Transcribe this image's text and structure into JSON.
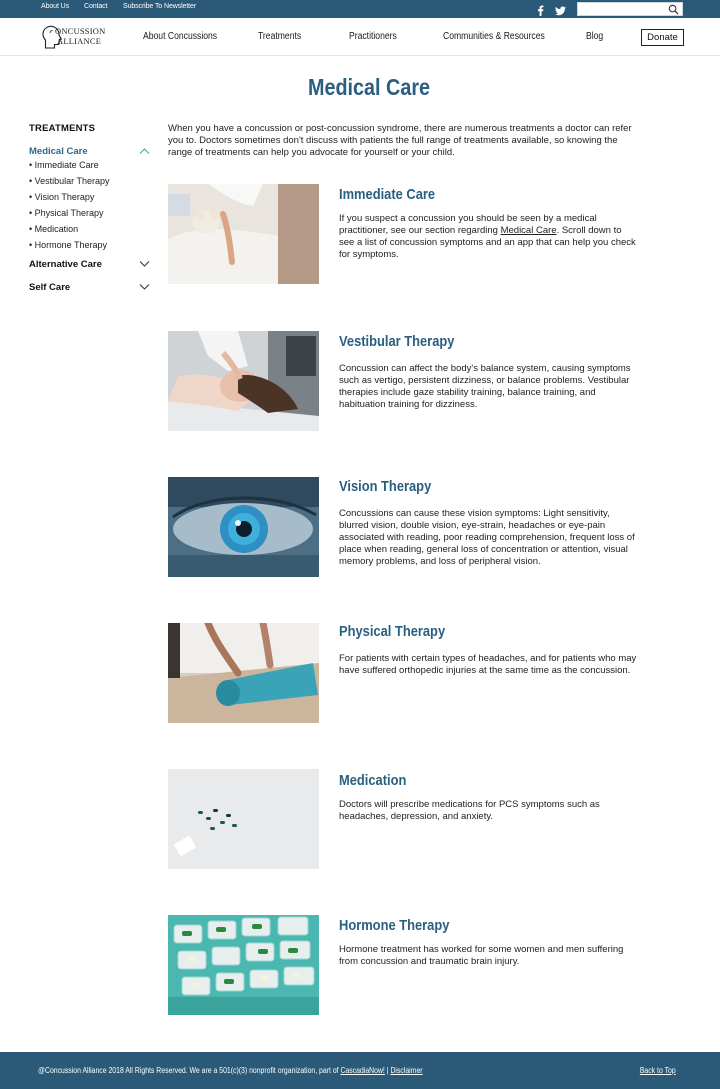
{
  "topbar": {
    "links": [
      "About Us",
      "Contact",
      "Subscribe To Newsletter"
    ],
    "social": [
      "facebook-icon",
      "twitter-icon"
    ],
    "search_placeholder": ""
  },
  "nav": {
    "logo_line1": "ONCUSSION",
    "logo_line2": "ALLIANCE",
    "items": [
      "About Concussions",
      "Treatments",
      "Practitioners",
      "Communities & Resources",
      "Blog"
    ],
    "donate": "Donate"
  },
  "page": {
    "title": "Medical Care",
    "intro": "When you have a concussion or post-concussion syndrome, there are numerous treatments a doctor can refer you to. Doctors sometimes don't discuss with patients the full range of treatments available, so knowing the range of treatments can help you advocate for yourself or your child."
  },
  "sidebar": {
    "heading": "TREATMENTS",
    "categories": [
      "Medical Care",
      "Alternative Care",
      "Self Care"
    ],
    "subitems": [
      "• Immediate Care",
      "• Vestibular Therapy",
      "• Vision Therapy",
      "• Physical Therapy",
      "• Medication",
      "• Hormone Therapy"
    ]
  },
  "treatments": [
    {
      "title": "Immediate Care",
      "desc_before": "If you suspect a concussion you should be seen by a medical practitioner, see our section regarding ",
      "desc_link": "Medical Care",
      "desc_after": ". Scroll down to see a list of concussion symptoms and an app that can help you check for symptoms."
    },
    {
      "title": "Vestibular Therapy",
      "desc": "Concussion can affect the body's balance system, causing symptoms such as vertigo, persistent dizziness, or balance problems. Vestibular therapies include gaze stability training, balance training, and habituation training for dizziness."
    },
    {
      "title": "Vision Therapy",
      "desc": "Concussions can cause these vision symptoms: Light sensitivity, blurred vision, double vision, eye-strain, headaches or eye-pain associated with reading, poor reading comprehension, frequent loss of place when reading, general loss of concentration or attention, visual memory problems, and loss of peripheral vision."
    },
    {
      "title": "Physical Therapy",
      "desc": "For patients with certain types of headaches, and for patients who may have suffered orthopedic injuries at the same time as the concussion."
    },
    {
      "title": "Medication",
      "desc": "Doctors will prescribe medications for PCS symptoms such as headaches, depression, and anxiety."
    },
    {
      "title": "Hormone Therapy",
      "desc": "Hormone treatment has worked for some women and men suffering from concussion and traumatic brain injury."
    }
  ],
  "footer": {
    "text": "@Concussion Alliance 2018 All Rights Reserved. We are a 501(c)(3) nonprofit organization, part of ",
    "link1": "CascadiaNow!",
    "sep": " | ",
    "link2": "Disclaimer",
    "back_to_top": "Back to Top"
  },
  "colors": {
    "brand": "#2a5a78",
    "heading": "#2a5f80",
    "accent": "#3aa8a0"
  }
}
